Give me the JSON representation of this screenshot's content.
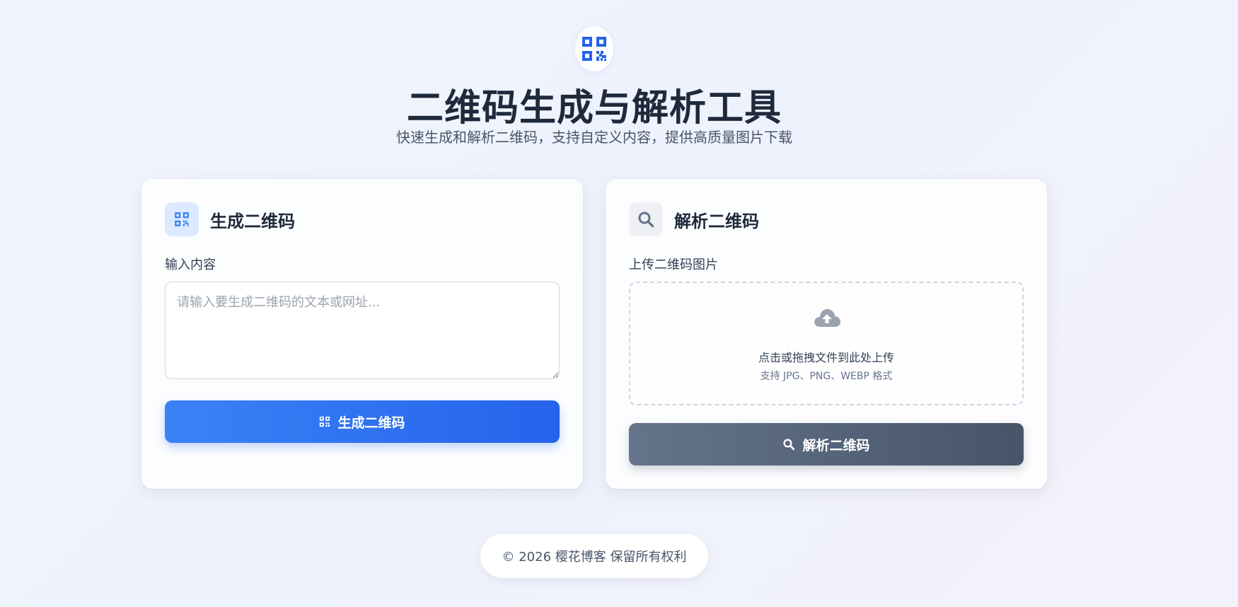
{
  "header": {
    "logo_icon": "qr-code-icon",
    "title": "二维码生成与解析工具",
    "subtitle": "快速生成和解析二维码，支持自定义内容，提供高质量图片下载"
  },
  "generate_card": {
    "icon": "qr-code-icon",
    "title": "生成二维码",
    "input_label": "输入内容",
    "input_placeholder": "请输入要生成二维码的文本或网址...",
    "input_value": "",
    "button_label": "生成二维码",
    "button_icon": "qr-code-icon"
  },
  "parse_card": {
    "icon": "search-icon",
    "title": "解析二维码",
    "upload_label": "上传二维码图片",
    "upload_icon": "cloud-upload-icon",
    "upload_hint": "点击或拖拽文件到此处上传",
    "upload_formats": "支持 JPG、PNG、WEBP 格式",
    "button_label": "解析二维码",
    "button_icon": "search-icon"
  },
  "footer": {
    "text": "© 2026 樱花博客 保留所有权利"
  },
  "colors": {
    "primary": "#2563eb",
    "primary_light": "#3b82f6",
    "slate": "#475569",
    "title": "#1e293b"
  }
}
